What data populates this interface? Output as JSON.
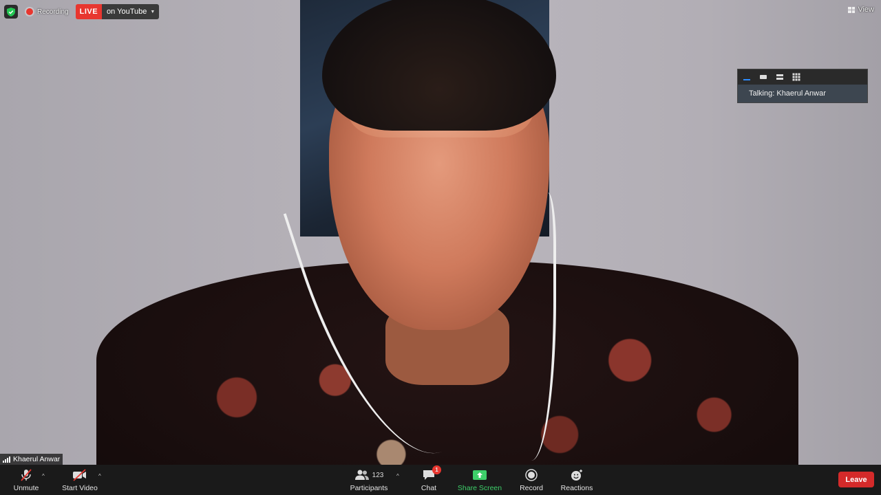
{
  "recording": {
    "label": "Recording",
    "live_badge": "LIVE",
    "stream_target": "on YouTube"
  },
  "view": {
    "label": "View"
  },
  "speaker_panel": {
    "talking_label": "Talking: Khaerul Anwar"
  },
  "participant": {
    "name": "Khaerul Anwar"
  },
  "toolbar": {
    "unmute_label": "Unmute",
    "start_video_label": "Start Video",
    "participants_label": "Participants",
    "participants_count": "123",
    "chat_label": "Chat",
    "chat_badge": "1",
    "share_screen_label": "Share Screen",
    "record_label": "Record",
    "reactions_label": "Reactions",
    "leave_label": "Leave"
  },
  "colors": {
    "live_red": "#e8362f",
    "share_green": "#3ecf6a",
    "leave_red": "#d42a2a",
    "toolbar_bg": "#1a1a1a"
  }
}
